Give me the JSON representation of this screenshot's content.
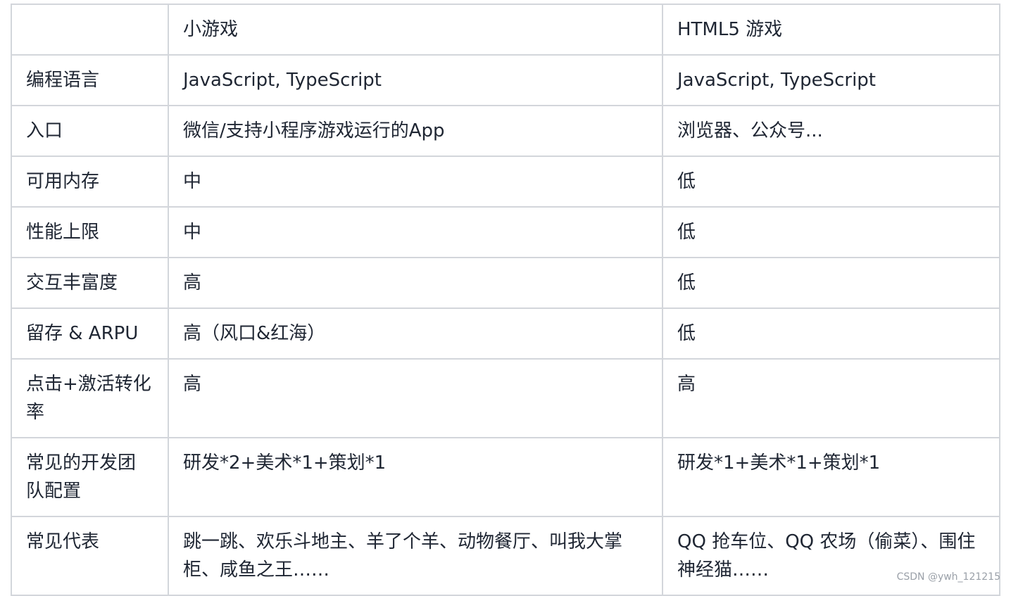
{
  "table": {
    "header": [
      "",
      "小游戏",
      "HTML5 游戏"
    ],
    "rows": [
      {
        "label": "编程语言",
        "mini": "JavaScript, TypeScript",
        "h5": "JavaScript, TypeScript"
      },
      {
        "label": "入口",
        "mini": "微信/支持小程序游戏运行的App",
        "h5": "浏览器、公众号..."
      },
      {
        "label": "可用内存",
        "mini": "中",
        "h5": "低"
      },
      {
        "label": "性能上限",
        "mini": "中",
        "h5": "低"
      },
      {
        "label": "交互丰富度",
        "mini": "高",
        "h5": "低"
      },
      {
        "label": "留存 & ARPU",
        "mini": "高（风口&红海）",
        "h5": "低"
      },
      {
        "label": "点击+激活转化率",
        "mini": "高",
        "h5": "高"
      },
      {
        "label": "常见的开发团队配置",
        "mini": "研发*2+美术*1+策划*1",
        "h5": "研发*1+美术*1+策划*1"
      },
      {
        "label": "常见代表",
        "mini": "跳一跳、欢乐斗地主、羊了个羊、动物餐厅、叫我大掌柜、咸鱼之王……",
        "h5": "QQ 抢车位、QQ 农场（偷菜）、围住神经猫……"
      }
    ]
  },
  "watermark": "CSDN @ywh_121215"
}
